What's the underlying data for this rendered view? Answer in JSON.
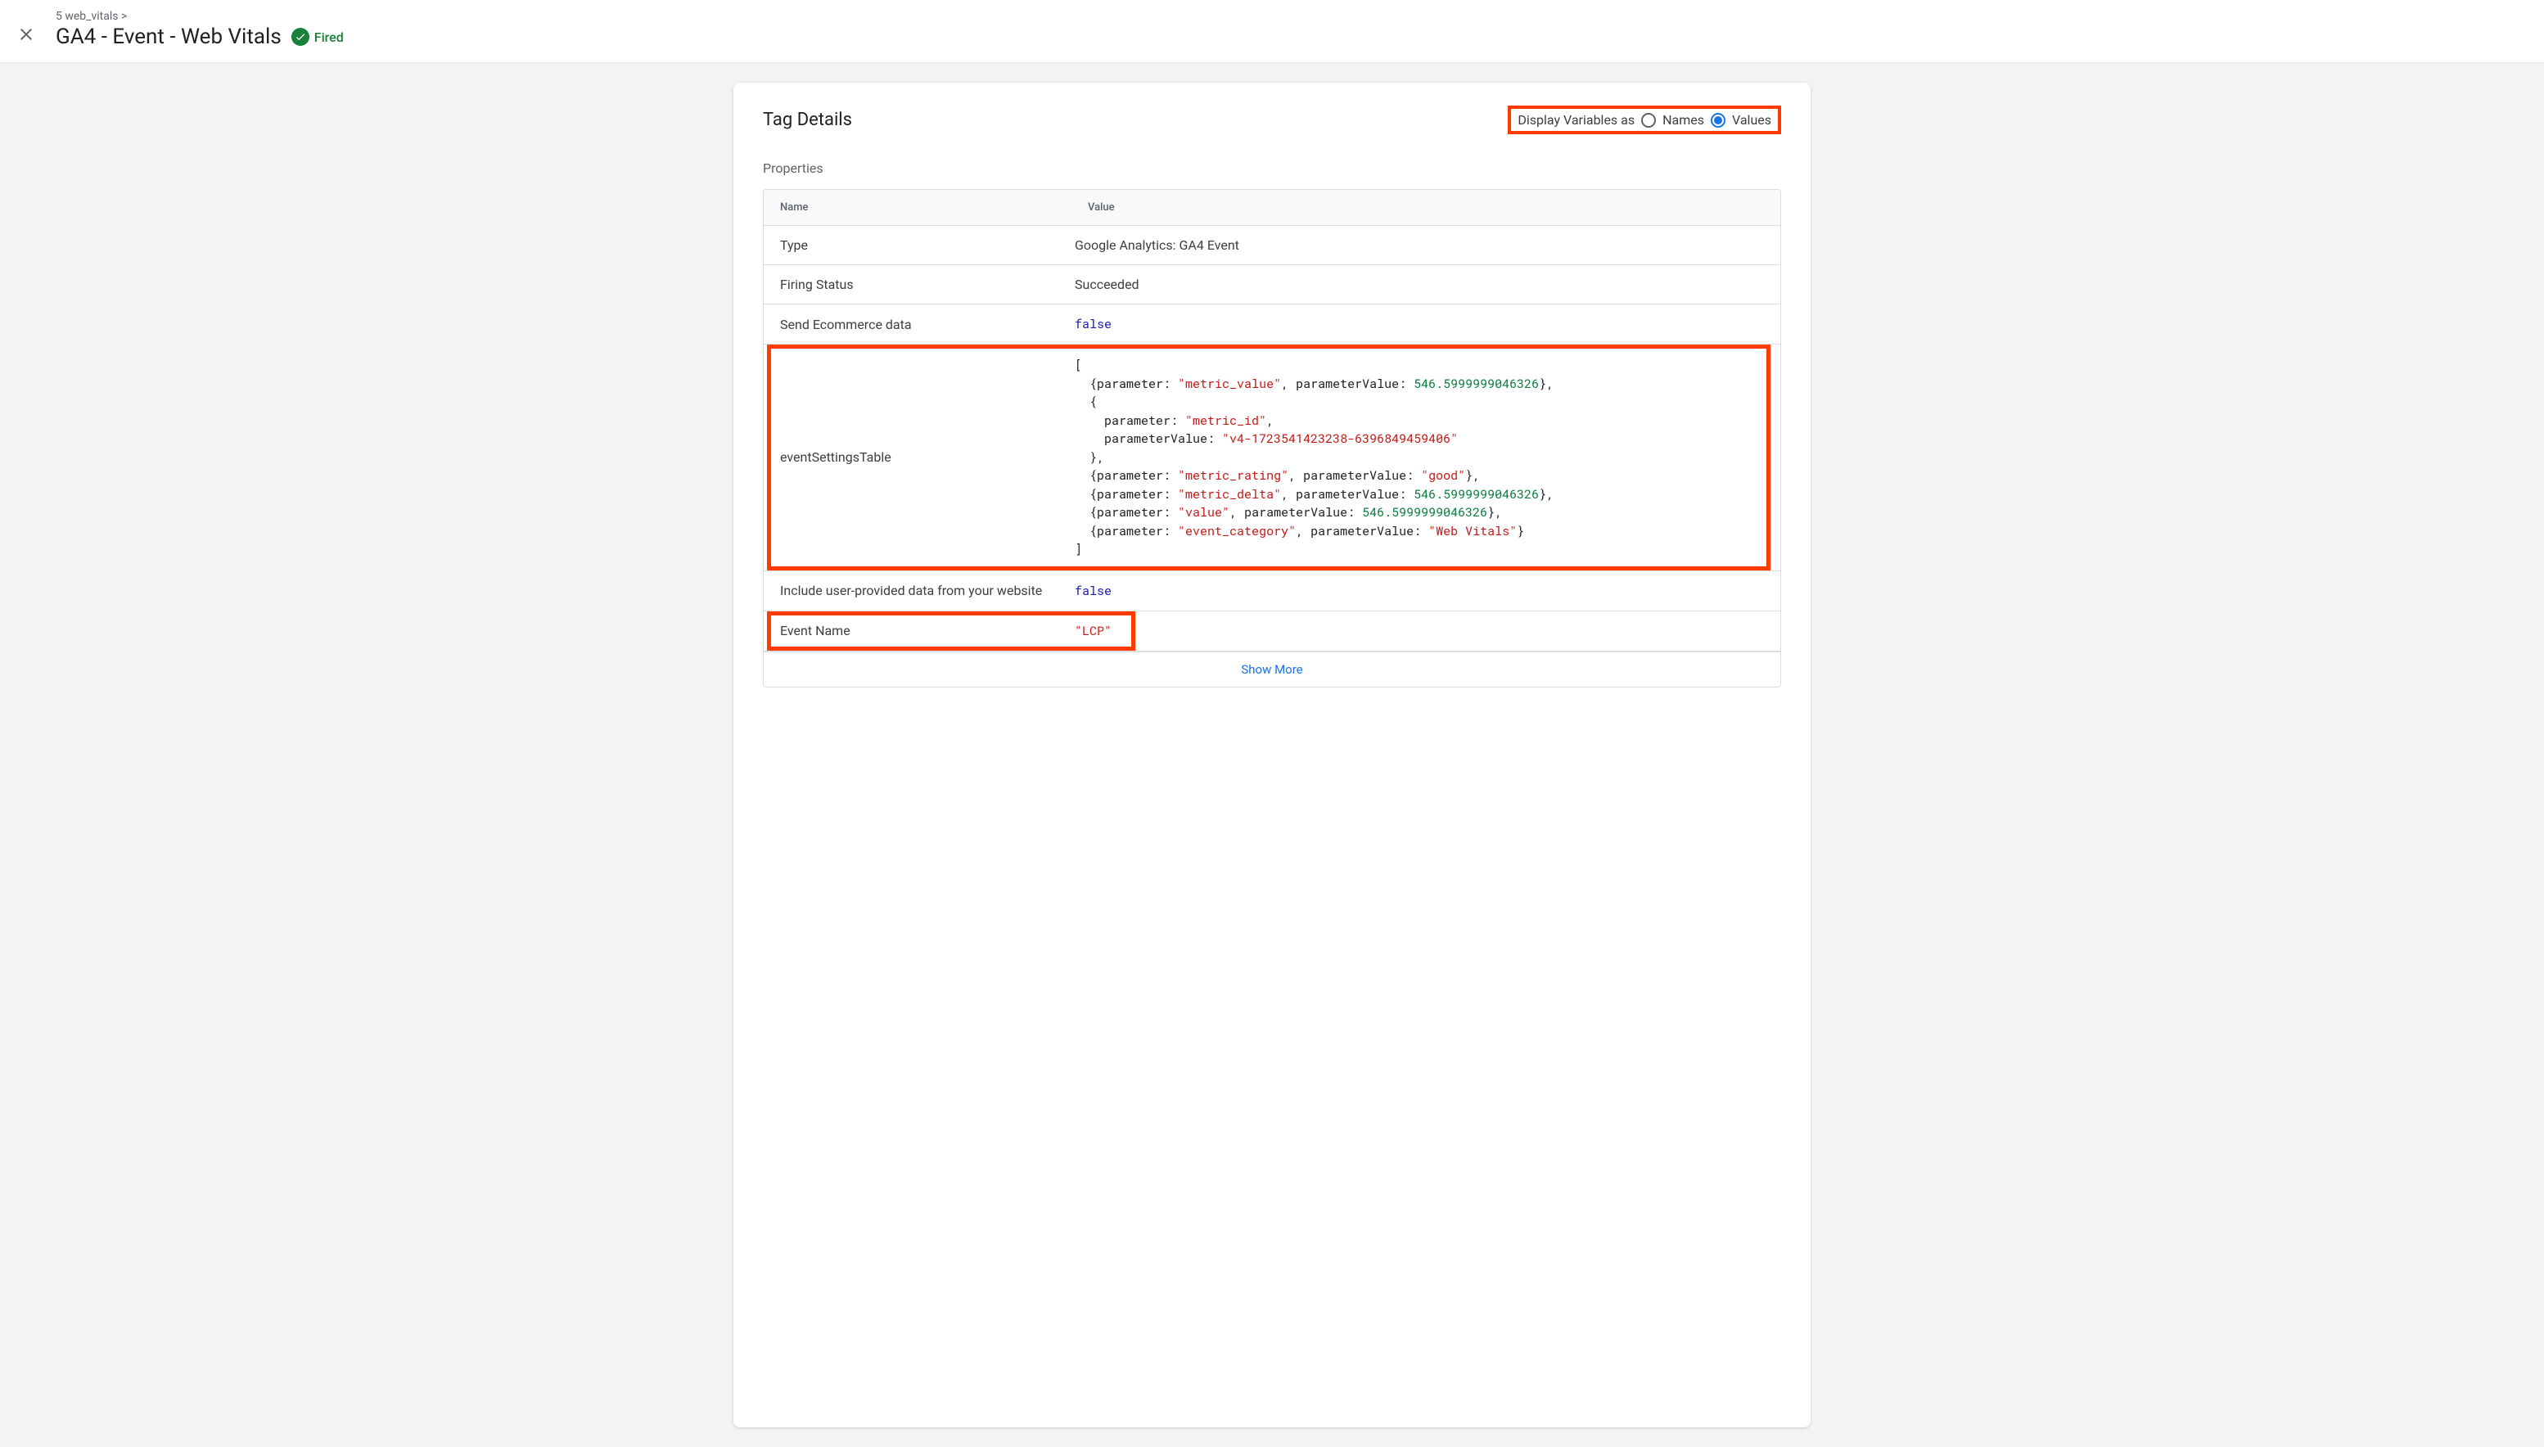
{
  "breadcrumb": "5 web_vitals >",
  "page_title": "GA4 - Event - Web Vitals",
  "fired_label": "Fired",
  "panel": {
    "title": "Tag Details",
    "display_toggle": {
      "label": "Display Variables as",
      "option_names": "Names",
      "option_values": "Values",
      "selected": "Values"
    },
    "properties_label": "Properties",
    "columns": {
      "name": "Name",
      "value": "Value"
    },
    "rows": {
      "type": {
        "name": "Type",
        "value": "Google Analytics: GA4 Event"
      },
      "firing_status": {
        "name": "Firing Status",
        "value": "Succeeded"
      },
      "send_ecommerce": {
        "name": "Send Ecommerce data",
        "value": "false"
      },
      "event_settings": {
        "name": "eventSettingsTable",
        "params": [
          {
            "parameter": "metric_value",
            "parameterValue": 546.5999999046326,
            "value_type": "number"
          },
          {
            "parameter": "metric_id",
            "parameterValue": "v4-1723541423238-6396849459406",
            "value_type": "string"
          },
          {
            "parameter": "metric_rating",
            "parameterValue": "good",
            "value_type": "string"
          },
          {
            "parameter": "metric_delta",
            "parameterValue": 546.5999999046326,
            "value_type": "number"
          },
          {
            "parameter": "value",
            "parameterValue": 546.5999999046326,
            "value_type": "number"
          },
          {
            "parameter": "event_category",
            "parameterValue": "Web Vitals",
            "value_type": "string"
          }
        ]
      },
      "include_user_data": {
        "name": "Include user-provided data from your website",
        "value": "false"
      },
      "event_name": {
        "name": "Event Name",
        "value": "\"LCP\""
      }
    },
    "show_more": "Show More"
  }
}
